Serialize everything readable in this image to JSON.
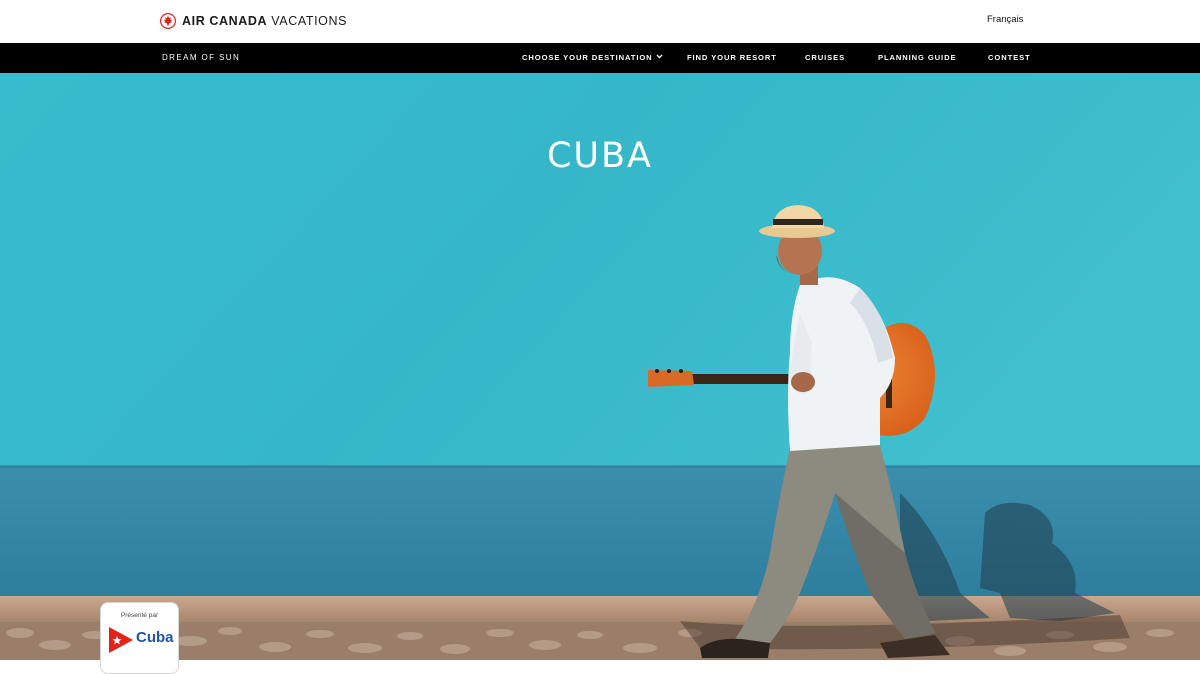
{
  "brand": {
    "name_bold": "AIR CANADA",
    "name_light": " VACATIONS",
    "logo_icon": "maple-leaf-rondelle-icon",
    "accent_color": "#e2231a"
  },
  "language_toggle": "Français",
  "nav": {
    "tagline": "DREAM OF SUN",
    "items": [
      "CHOOSE YOUR DESTINATION",
      "FIND YOUR RESORT",
      "CRUISES",
      "PLANNING GUIDE",
      "CONTEST"
    ],
    "dropdown_icon": "chevron-down-icon"
  },
  "hero": {
    "title": "CUBA",
    "wall_color": "#33b5c8",
    "base_color": "#2f8ea9"
  },
  "sponsor": {
    "label": "Présenté par",
    "name": "Cuba",
    "flag_icon": "cuba-flag-icon"
  }
}
